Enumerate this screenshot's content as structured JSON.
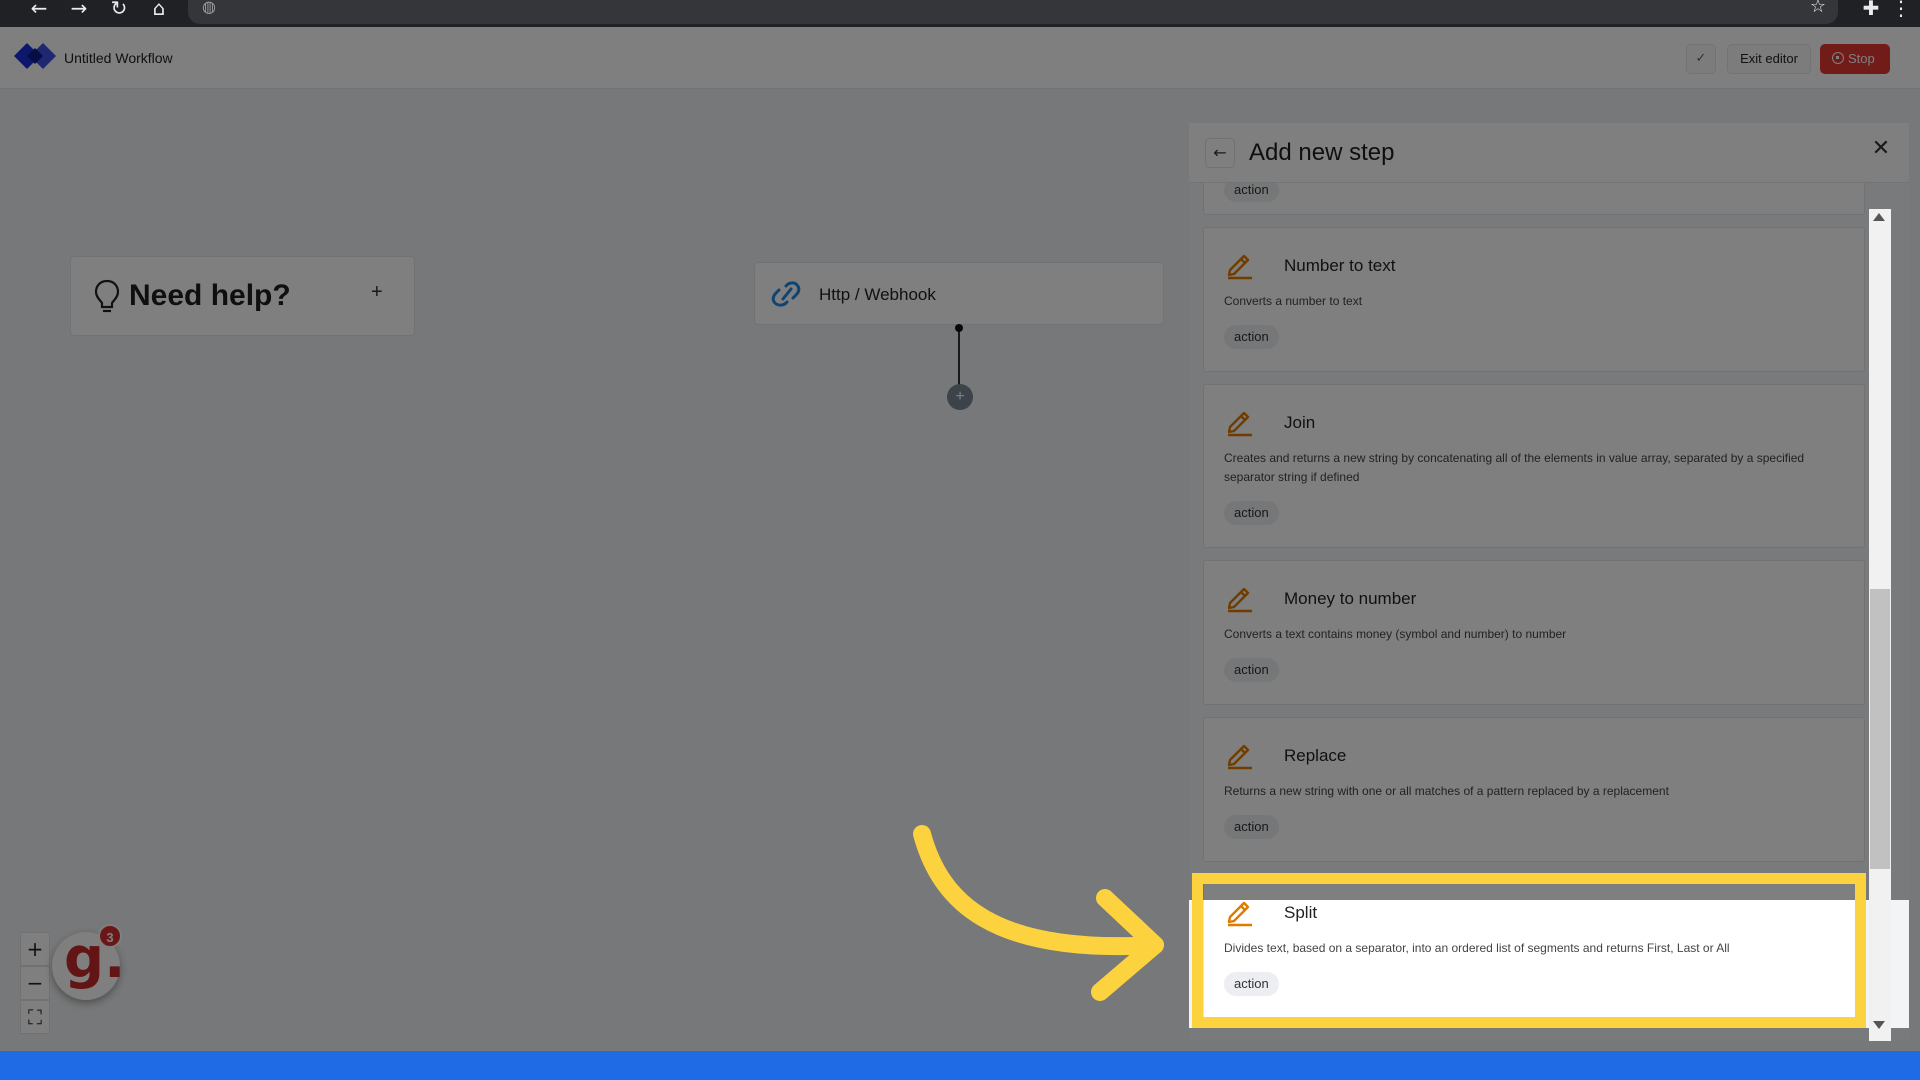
{
  "app": {
    "workflow_title": "Untitled Workflow",
    "exit_editor": "Exit editor",
    "stop": "Stop",
    "check_icon": "✓"
  },
  "canvas": {
    "help_title": "Need help?",
    "help_toggle": "+",
    "trigger_label": "Http / Webhook",
    "add_node": "+",
    "zoom_in": "+",
    "zoom_out": "−",
    "fit": "⛶"
  },
  "badge": {
    "letter": "g.",
    "count": "3"
  },
  "panel": {
    "title": "Add new step",
    "back": "←",
    "close": "✕",
    "steps": [
      {
        "name": "",
        "description": "",
        "tag": "action"
      },
      {
        "name": "Number to text",
        "description": "Converts a number to text",
        "tag": "action"
      },
      {
        "name": "Join",
        "description": "Creates and returns a new string by concatenating all of the elements in value array, separated by a specified separator string if defined",
        "tag": "action"
      },
      {
        "name": "Money to number",
        "description": "Converts a text contains money (symbol and number) to number",
        "tag": "action"
      },
      {
        "name": "Replace",
        "description": "Returns a new string with one or all matches of a pattern replaced by a replacement",
        "tag": "action"
      },
      {
        "name": "Split",
        "description": "Divides text, based on a separator, into an ordered list of segments and returns First, Last or All",
        "tag": "action"
      }
    ]
  },
  "colors": {
    "highlight": "#fcd33f",
    "stop": "#e53935",
    "pencil": "#e07b00",
    "brand": "#1a2fd8",
    "bottom_bar": "#1f6be6"
  }
}
